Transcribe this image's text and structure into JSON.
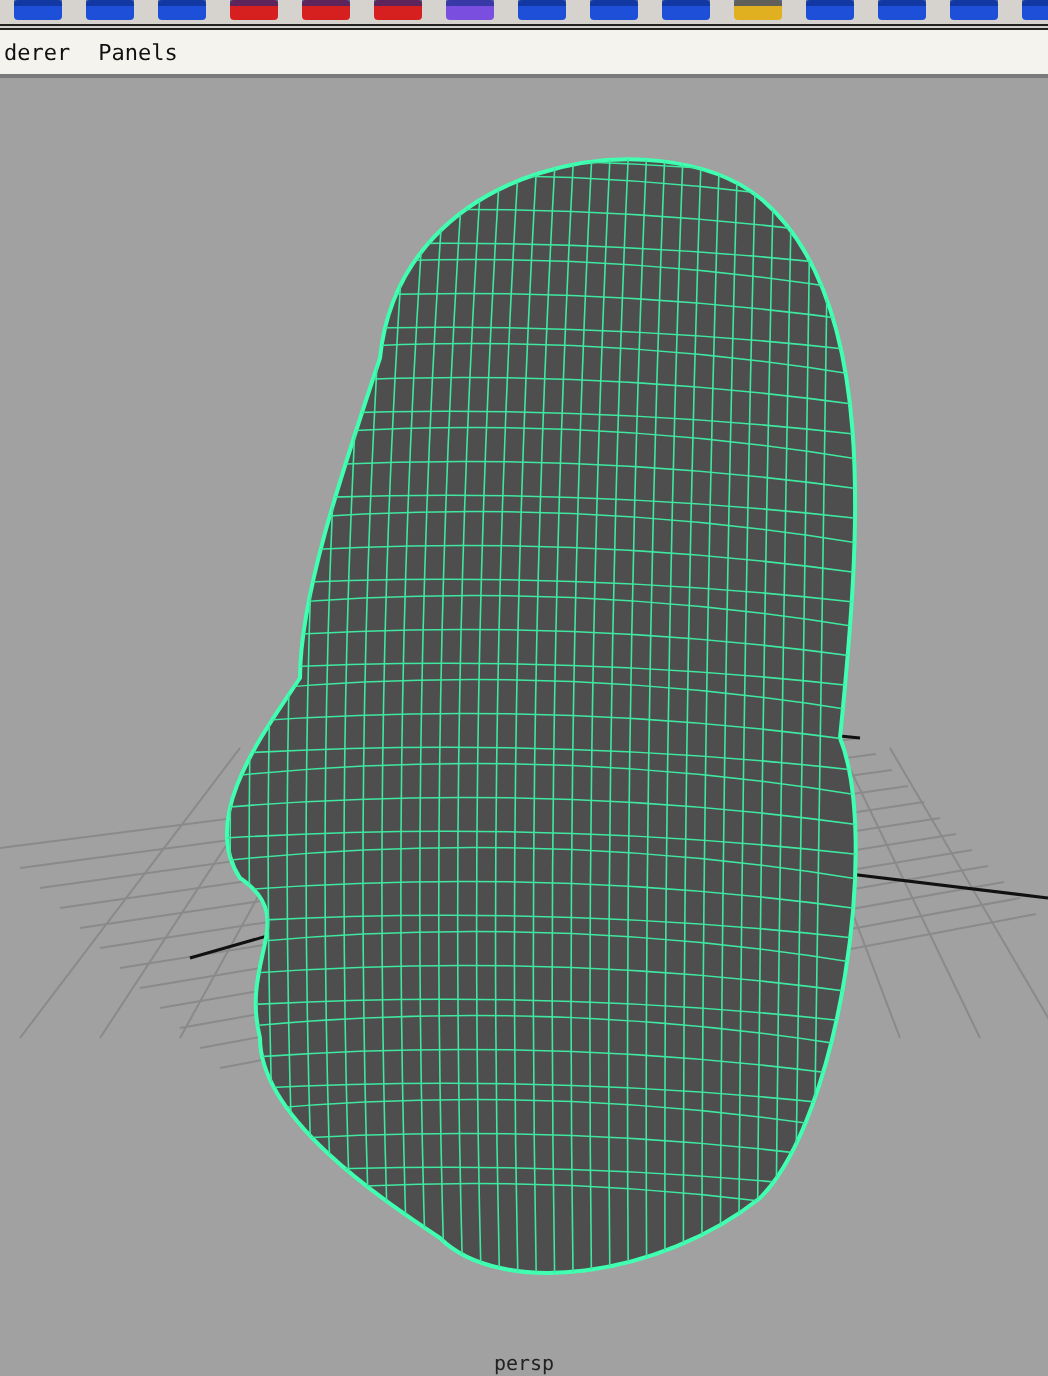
{
  "menu_bar": {
    "items": [
      {
        "label": "derer"
      },
      {
        "label": "Panels"
      }
    ]
  },
  "viewport": {
    "camera_label": "persp"
  }
}
